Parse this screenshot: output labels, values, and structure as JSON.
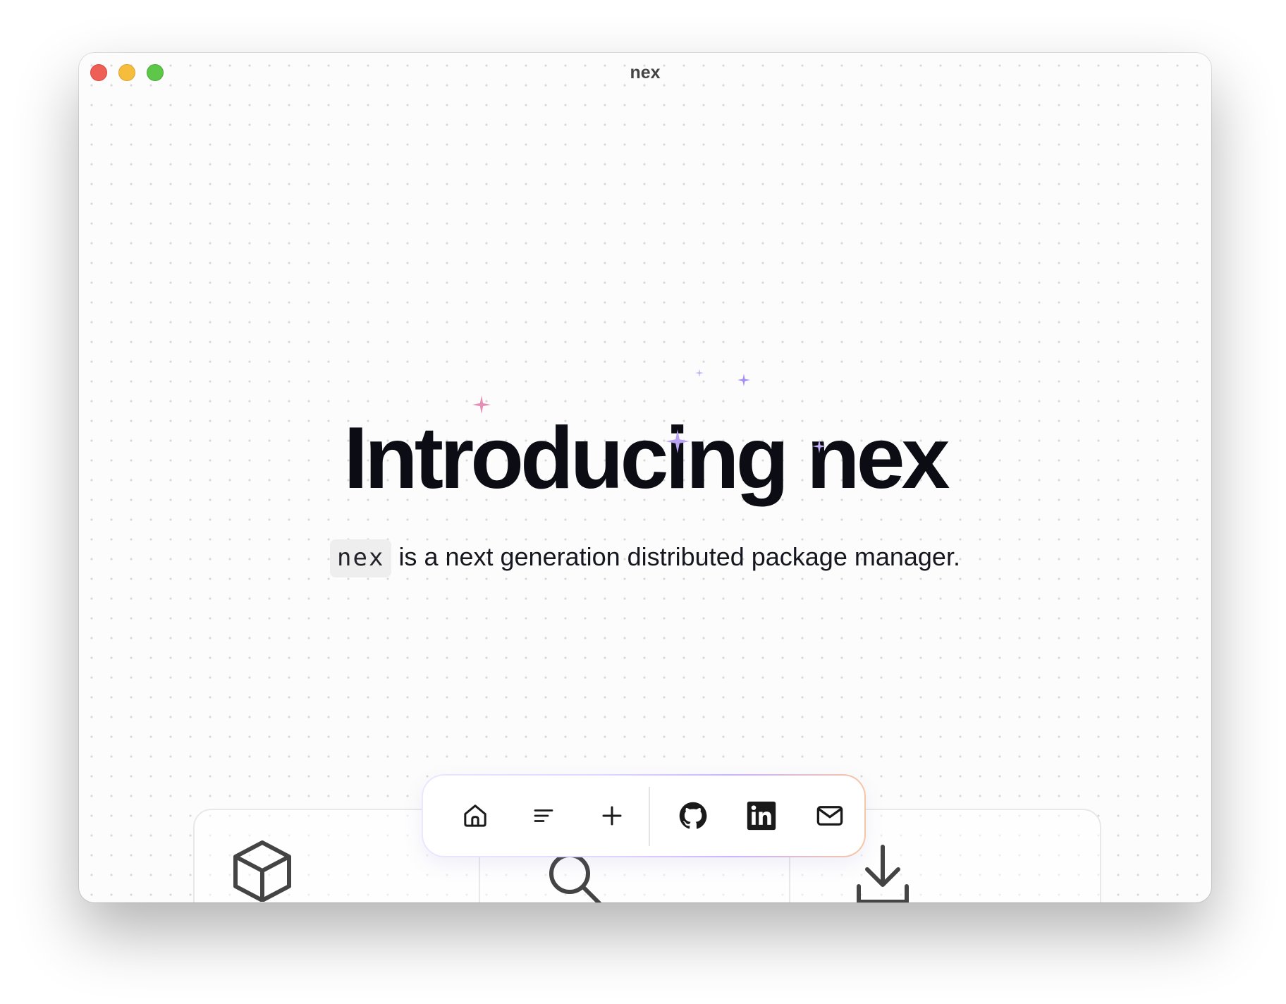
{
  "window": {
    "title": "nex"
  },
  "hero": {
    "headline": "Introducing nex",
    "code_chip": "nex",
    "subline": "is a next generation distributed package manager."
  },
  "dock": {
    "items": [
      {
        "icon": "home-icon"
      },
      {
        "icon": "menu-icon"
      },
      {
        "icon": "plus-icon"
      },
      {
        "icon": "github-icon"
      },
      {
        "icon": "linkedin-icon"
      },
      {
        "icon": "mail-icon"
      }
    ]
  },
  "cards": {
    "icons": [
      "package-box-icon",
      "search-icon",
      "download-icon"
    ]
  },
  "colors": {
    "headline": "#0c0c14",
    "sparkle_purple": "#b9a2f5",
    "sparkle_pink": "#e58fb6",
    "dock_gradient_end": "#f7c6a3"
  }
}
